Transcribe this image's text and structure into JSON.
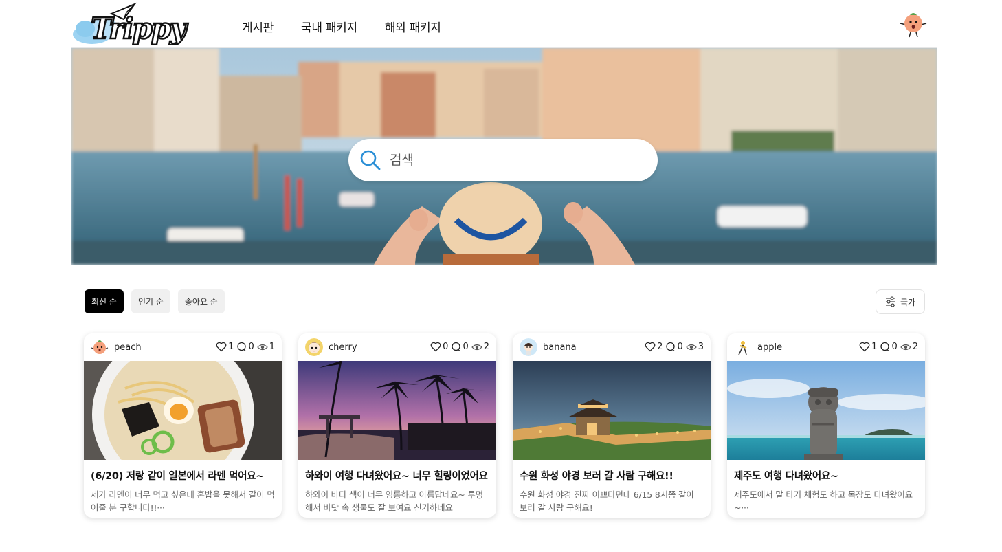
{
  "header": {
    "logo_text": "Trippy",
    "nav": [
      "게시판",
      "국내 패키지",
      "해외 패키지"
    ]
  },
  "hero": {
    "search_placeholder": "검색"
  },
  "sort": {
    "options": [
      "최신 순",
      "인기 순",
      "좋아요 순"
    ],
    "active": "최신 순",
    "filter_label": "국가"
  },
  "cards": [
    {
      "user": "peach",
      "likes": "1",
      "comments": "0",
      "views": "1",
      "title": "(6/20) 저랑 같이 일본에서 라멘 먹어요~",
      "desc": "제가 라멘이 너무 먹고 싶은데 혼밥을 못해서 같이 먹어줄 분 구합니다!!···",
      "image": "ramen"
    },
    {
      "user": "cherry",
      "likes": "0",
      "comments": "0",
      "views": "2",
      "title": "하와이 여행 다녀왔어요~ 너무 힐링이었어요",
      "desc": "하와이 바다 색이 너무 영롱하고 아름답네요~ 투명해서 바닷 속 생물도 잘 보여요 신기하네요",
      "image": "hawaii-sunset"
    },
    {
      "user": "banana",
      "likes": "2",
      "comments": "0",
      "views": "3",
      "title": "수원 화성 야경 보러 갈 사람 구해요!!",
      "desc": "수원 화성 야경 진짜 이쁘다던데 6/15 8시쯤 같이 보러 갈 사람 구해요!",
      "image": "suwon-fortress-night"
    },
    {
      "user": "apple",
      "likes": "1",
      "comments": "0",
      "views": "2",
      "title": "제주도 여행 다녀왔어요~",
      "desc": "제주도에서 말 타기 체험도 하고 목장도 다녀왔어요~···",
      "image": "jeju-dolharubang"
    }
  ],
  "colors": {
    "accent": "#2b8fd6",
    "active_sort_bg": "#000000",
    "sort_bg": "#f0f0f0"
  }
}
